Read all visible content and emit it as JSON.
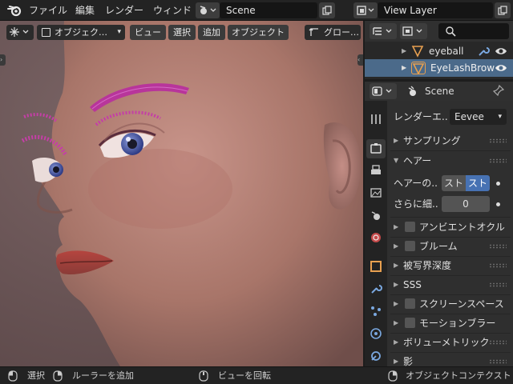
{
  "menu": {
    "file": "ファイル",
    "edit": "編集",
    "render": "レンダー",
    "window": "ウィンド"
  },
  "scene_field": "Scene",
  "view_layer_field": "View Layer",
  "viewport": {
    "object_mode": "オブジェク…",
    "view": "ビュー",
    "select": "選択",
    "add": "追加",
    "object": "オブジェクト",
    "transform": "グロー…"
  },
  "outliner": {
    "items": [
      {
        "label": "eyeball"
      },
      {
        "label": "EyeLashBrow"
      }
    ]
  },
  "properties": {
    "context": "Scene",
    "render_engine_label": "レンダーエ..",
    "render_engine_value": "Eevee",
    "sampling": "サンプリング",
    "hair": "ヘアー",
    "hair_shape_label": "ヘアーの..",
    "hair_opt1": "スト",
    "hair_opt2": "スト",
    "subdiv_label": "さらに細..",
    "subdiv_value": "0",
    "ao": "アンビエントオクル",
    "bloom": "ブルーム",
    "dof": "被写界深度",
    "sss": "SSS",
    "ssr": "スクリーンスペース",
    "motion_blur": "モーションブラー",
    "volumetrics": "ボリューメトリック",
    "shadows": "影"
  },
  "status": {
    "select": "選択",
    "add_ruler": "ルーラーを追加",
    "rotate_view": "ビューを回転",
    "object_context": "オブジェクトコンテクスト"
  },
  "colors": {
    "accent": "#4772b3",
    "selected_row": "#4b6a8a",
    "eyelash": "#c43fa6",
    "iris": "#3c4fa0"
  }
}
